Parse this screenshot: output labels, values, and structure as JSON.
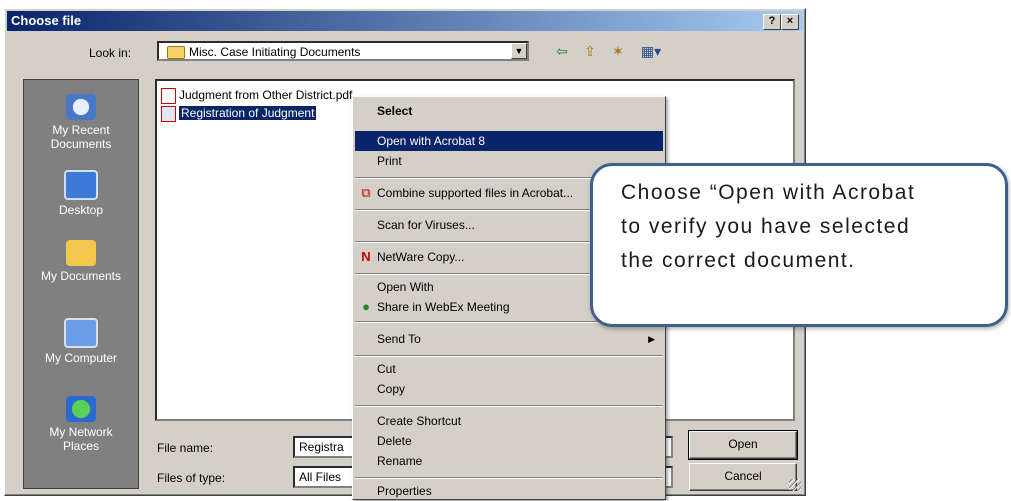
{
  "dialog": {
    "title": "Choose file",
    "help_label": "?",
    "close_label": "×"
  },
  "lookin": {
    "label": "Look in:",
    "value": "Misc. Case Initiating Documents"
  },
  "toolbar_icons": [
    "back-icon",
    "up-folder-icon",
    "new-folder-icon",
    "view-menu-icon"
  ],
  "places": [
    {
      "label": "My Recent\nDocuments",
      "icon": "recent-documents-icon"
    },
    {
      "label": "Desktop",
      "icon": "desktop-icon"
    },
    {
      "label": "My Documents",
      "icon": "my-documents-icon"
    },
    {
      "label": "My Computer",
      "icon": "my-computer-icon"
    },
    {
      "label": "My Network\nPlaces",
      "icon": "network-places-icon"
    }
  ],
  "files": [
    {
      "name": "Judgment from Other District.pdf",
      "selected": false,
      "icon": "pdf-file-icon"
    },
    {
      "name": "Registration of Judgment",
      "selected": true,
      "icon": "pdf-file-icon"
    }
  ],
  "filename": {
    "label": "File name:",
    "value": "Registra"
  },
  "filetype": {
    "label": "Files of type:",
    "value": "All Files"
  },
  "buttons": {
    "open": "Open",
    "cancel": "Cancel"
  },
  "context_menu": {
    "items": [
      {
        "label": "Select",
        "bold": true
      },
      {
        "label": "Open with Acrobat 8",
        "highlighted": true
      },
      {
        "label": "Print"
      },
      {
        "label": "Combine supported files in Acrobat...",
        "icon": "acrobat-combine-icon"
      },
      {
        "label": "Scan for Viruses..."
      },
      {
        "label": "NetWare Copy...",
        "icon": "netware-icon"
      },
      {
        "label": "Open With"
      },
      {
        "label": "Share in WebEx Meeting",
        "icon": "webex-icon"
      },
      {
        "label": "Send To",
        "submenu": true
      },
      {
        "label": "Cut"
      },
      {
        "label": "Copy"
      },
      {
        "label": "Create Shortcut"
      },
      {
        "label": "Delete"
      },
      {
        "label": "Rename"
      },
      {
        "label": "Properties"
      }
    ]
  },
  "callout": {
    "text": "Choose “Open with Acrobat\nto verify you have selected\nthe correct document."
  },
  "colors": {
    "titlebar_start": "#0a246a",
    "titlebar_end": "#a6caf0",
    "selection": "#0a246a",
    "callout_border": "#3f5f8f"
  }
}
